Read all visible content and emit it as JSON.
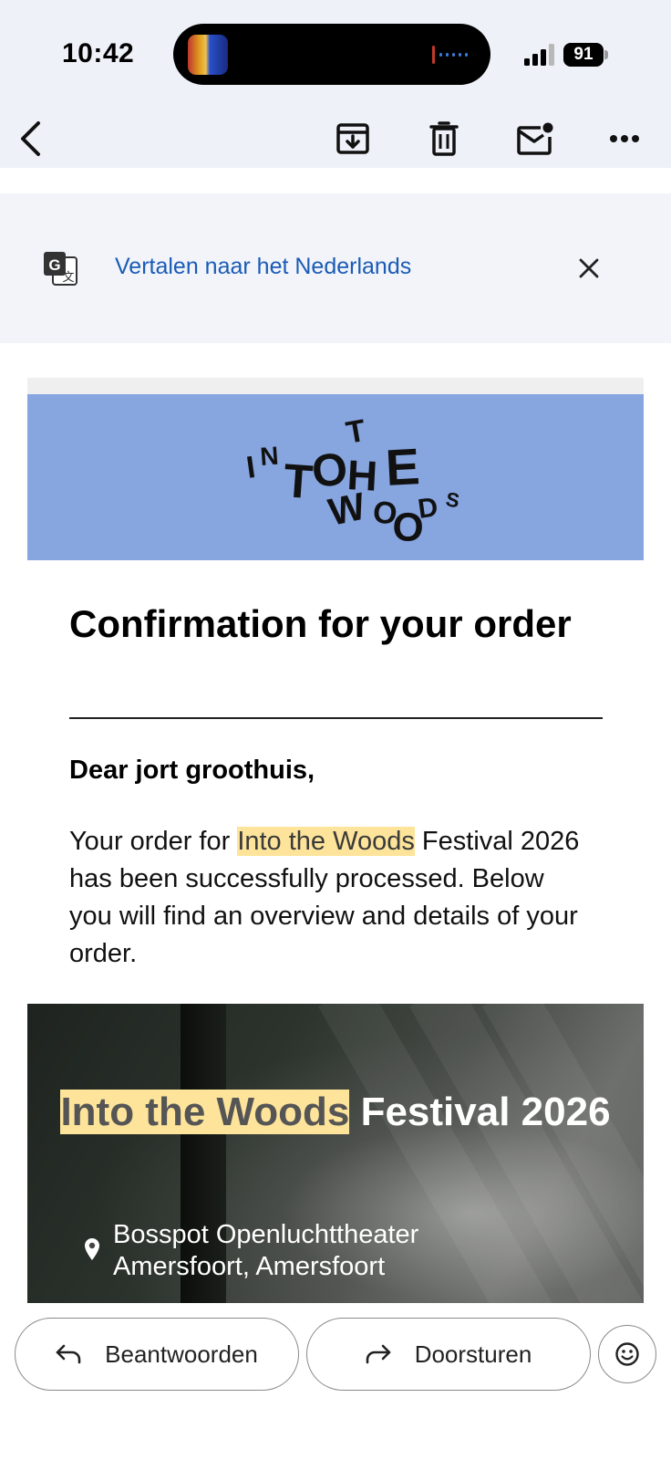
{
  "status_bar": {
    "time": "10:42",
    "battery": "91",
    "icons": [
      "now-playing-artwork-icon",
      "audio-waveform-icon",
      "cellular-signal-icon",
      "battery-icon"
    ]
  },
  "toolbar": {
    "icons": [
      "back-arrow-icon",
      "archive-icon",
      "trash-icon",
      "mark-unread-icon",
      "more-options-icon"
    ]
  },
  "translate_banner": {
    "link_text": "Vertalen naar het Nederlands",
    "icons": [
      "translate-icon",
      "close-icon"
    ]
  },
  "email": {
    "logo": {
      "text": "INTO THE WOODS",
      "header_color": "#87a5df"
    },
    "title": "Confirmation for your order",
    "greeting": "Dear jort groothuis,",
    "body": {
      "prefix": "Your order for ",
      "highlight": "Into the Woods",
      "suffix": " Festival 2026 has been successfully processed. Below you will find an overview and details of your order."
    },
    "hero": {
      "title_highlight": "Into the Woods",
      "title_rest": " Festival 2026",
      "location_line1": "Bosspot Openluchttheater",
      "location_line2": "Amersfoort, Amersfoort"
    },
    "highlight_color": "#fde49a"
  },
  "actions": {
    "reply_label": "Beantwoorden",
    "forward_label": "Doorsturen",
    "icons": [
      "reply-icon",
      "forward-icon",
      "emoji-reaction-icon"
    ]
  }
}
